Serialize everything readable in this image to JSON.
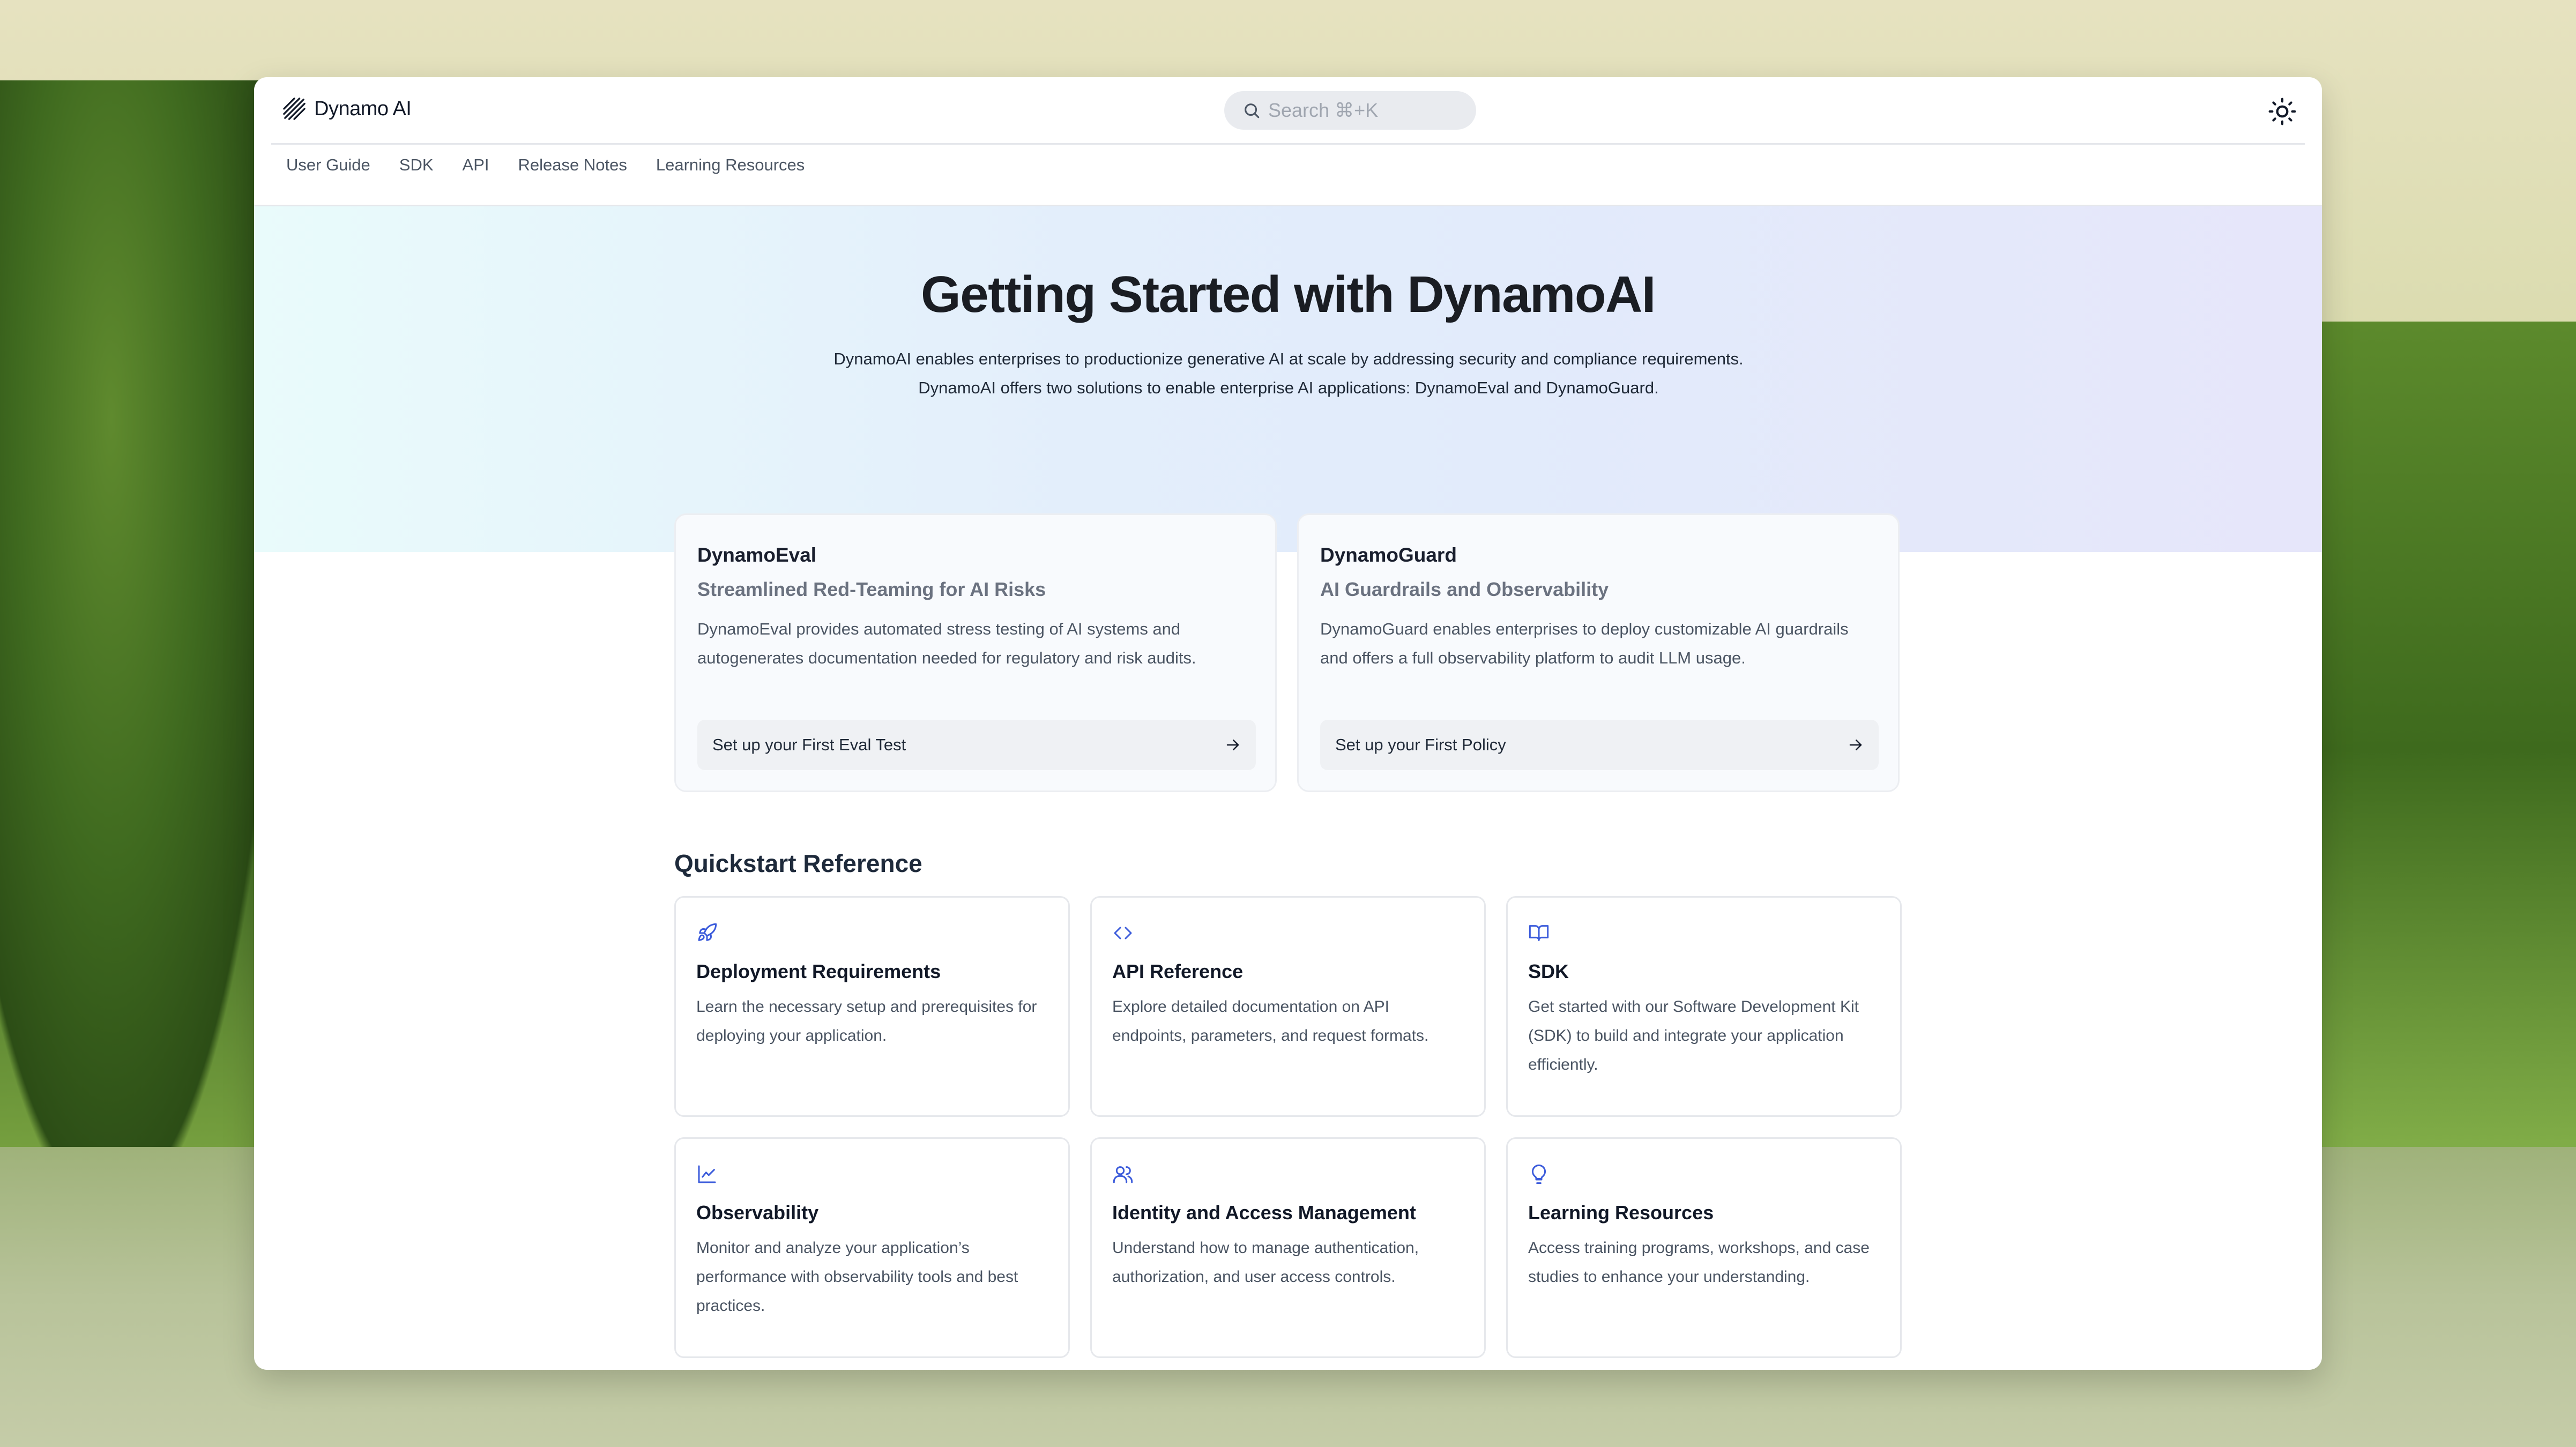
{
  "header": {
    "logo_text": "Dynamo AI",
    "search_placeholder": "Search ⌘+K"
  },
  "nav": {
    "items": [
      {
        "label": "User Guide"
      },
      {
        "label": "SDK"
      },
      {
        "label": "API"
      },
      {
        "label": "Release Notes"
      },
      {
        "label": "Learning Resources"
      }
    ]
  },
  "hero": {
    "title": "Getting Started with DynamoAI",
    "description": "DynamoAI enables enterprises to productionize generative AI at scale by addressing security and compliance requirements. DynamoAI offers two solutions to enable enterprise AI applications: DynamoEval and DynamoGuard."
  },
  "solutions": [
    {
      "name": "DynamoEval",
      "tagline": "Streamlined Red-Teaming for AI Risks",
      "description": "DynamoEval provides automated stress testing of AI systems and autogenerates documentation needed for regulatory and risk audits.",
      "cta": "Set up your First Eval Test"
    },
    {
      "name": "DynamoGuard",
      "tagline": "AI Guardrails and Observability",
      "description": "DynamoGuard enables enterprises to deploy customizable AI guardrails and offers a full observability platform to audit LLM usage.",
      "cta": "Set up your First Policy"
    }
  ],
  "quickstart": {
    "title": "Quickstart Reference",
    "cards": [
      {
        "icon": "rocket-icon",
        "title": "Deployment Requirements",
        "description": "Learn the necessary setup and prerequisites for deploying your application."
      },
      {
        "icon": "code-icon",
        "title": "API Reference",
        "description": "Explore detailed documentation on API endpoints, parameters, and request formats."
      },
      {
        "icon": "book-icon",
        "title": "SDK",
        "description": "Get started with our Software Development Kit (SDK) to build and integrate your application efficiently."
      },
      {
        "icon": "chart-icon",
        "title": "Observability",
        "description": "Monitor and analyze your application’s performance with observability tools and best practices."
      },
      {
        "icon": "users-icon",
        "title": "Identity and Access Management",
        "description": "Understand how to manage authentication, authorization, and user access controls."
      },
      {
        "icon": "lightbulb-icon",
        "title": "Learning Resources",
        "description": "Access training programs, workshops, and case studies to enhance your understanding."
      }
    ]
  },
  "colors": {
    "accent": "#3b5bdb",
    "text_primary": "#111827",
    "text_secondary": "#4b5563"
  }
}
